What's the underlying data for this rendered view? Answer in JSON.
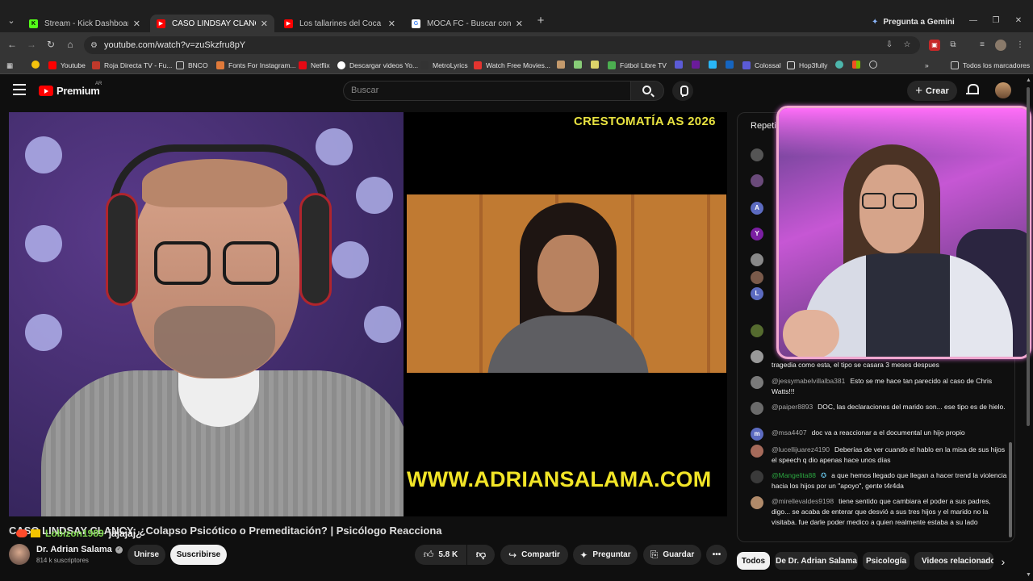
{
  "browser": {
    "tabs": [
      {
        "title": "Stream - Kick Dashboard",
        "color": "#53fc18",
        "glyph": "K",
        "active": false
      },
      {
        "title": "CASO LINDSAY CLANCY: ¿Colap",
        "color": "#ff0000",
        "glyph": "▶",
        "active": true
      },
      {
        "title": "Los tallarines del Coca Mendoz",
        "color": "#ff0000",
        "glyph": "▶",
        "active": false
      },
      {
        "title": "MOCA FC - Buscar con Google",
        "color": "#ffffff",
        "glyph": "G",
        "active": false
      }
    ],
    "gemini_label": "Pregunta a Gemini",
    "url": "youtube.com/watch?v=zuSkzfru8pY",
    "bookmarks": [
      {
        "label": "Youtube",
        "color": "#ff0000"
      },
      {
        "label": "Roja Directa TV - Fu...",
        "color": "#c0392b"
      },
      {
        "label": "BNCO",
        "color": "#c7c7c7"
      },
      {
        "label": "Fonts For Instagram...",
        "color": "#e07a3a"
      },
      {
        "label": "Netflix",
        "color": "#e50914"
      },
      {
        "label": "Descargar videos Yo...",
        "color": "#ffffff"
      },
      {
        "label": "MetroLyrics",
        "color": "#333333"
      },
      {
        "label": "Watch Free Movies...",
        "color": "#e3342f"
      },
      {
        "label": "Fútbol Libre TV",
        "color": "#4caf50"
      },
      {
        "label": "Colossal",
        "color": "#5b5bd6"
      },
      {
        "label": "Hop3fully",
        "color": "#dddddd"
      }
    ],
    "all_bookmarks": "Todos los marcadores"
  },
  "youtube": {
    "logo_text": "Premium",
    "logo_region": "AR",
    "search_placeholder": "Buscar",
    "create_label": "Crear"
  },
  "video": {
    "banner_text": "CRESTOMATÍA AS 2026",
    "site_text": "WWW.ADRIANSALAMA.COM",
    "overlay_user": "Lobizon1989",
    "overlay_message": "jajajaj¿",
    "title": "CASO LINDSAY CLANCY: ¿Colapso Psicótico o Premeditación? | Psicólogo Reacciona",
    "channel_name": "Dr. Adrian Salama",
    "subscribers": "814 k suscriptores",
    "join_label": "Unirse",
    "subscribe_label": "Suscribirse",
    "likes": "5.8 K",
    "share_label": "Compartir",
    "ask_label": "Preguntar",
    "save_label": "Guardar"
  },
  "chat": {
    "header": "Repeti",
    "messages": [
      {
        "user": "@jessymabelvillalba381",
        "text": "Esto se me hace tan parecido al caso de Chris Watts!!!",
        "avatar": "",
        "color": "#7a7a7a"
      },
      {
        "user": "@paiper8893",
        "text": "DOC, las declaraciones del marido son... ese tipo es de hielo.",
        "avatar": "",
        "color": "#6b6b6b"
      },
      {
        "user": "@msa4407",
        "text": "doc va a reaccionar a el documental un hijo propio",
        "avatar": "m",
        "color": "#5c6bc0"
      },
      {
        "user": "@lucellijuarez4190",
        "text": "Deberías de ver cuando el hablo en la misa de sus hijos el speech q dio apenas hace unos días",
        "avatar": "",
        "color": "#a56a5a"
      },
      {
        "user": "@Mangelita88",
        "text": "a que hemos llegado que llegan a hacer trend la violencia hacia los hijos por un \"apoyo\", gente t4r4da",
        "avatar": "",
        "color": "#3a3a3a",
        "member": true
      },
      {
        "user": "@mirellevaldes9198",
        "text": "tiene sentido que cambiara el poder a sus padres, digo... se acaba de enterar que desvió a sus tres hijos y el marido no la visitaba. fue darle poder medico a quien realmente estaba a su lado",
        "avatar": "",
        "color": "#b08a6a"
      }
    ],
    "partial_line": "tragedia como esta, el tipo se casara 3 meses despues"
  },
  "chips": [
    {
      "label": "Todos",
      "active": true
    },
    {
      "label": "De Dr. Adrian Salama",
      "active": false
    },
    {
      "label": "Psicología",
      "active": false
    },
    {
      "label": "Videos relacionado",
      "active": false
    }
  ]
}
